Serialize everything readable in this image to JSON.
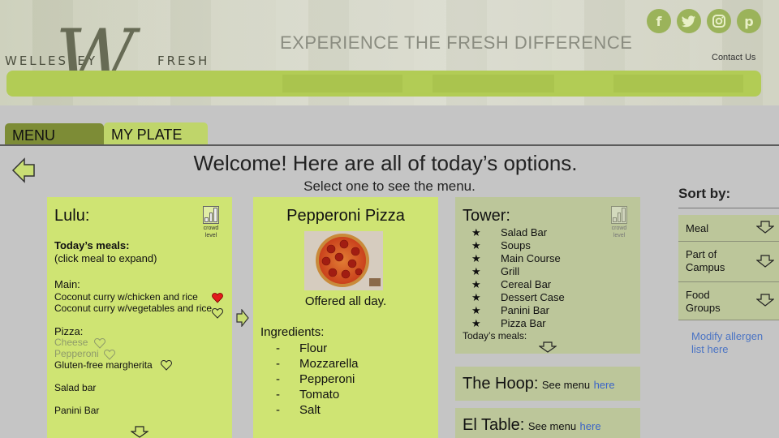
{
  "header": {
    "logo_left": "WELLESLEY",
    "logo_letter": "W",
    "logo_right": "FRESH",
    "tagline": "EXPERIENCE THE FRESH DIFFERENCE",
    "contact_label": "Contact Us",
    "social_icons": [
      {
        "name": "facebook-icon",
        "glyph": "f"
      },
      {
        "name": "twitter-icon",
        "glyph": "t"
      },
      {
        "name": "instagram-icon",
        "glyph": "◎"
      },
      {
        "name": "pinterest-icon",
        "glyph": "p"
      }
    ]
  },
  "tabs": {
    "menu": "MENU",
    "my_plate": "MY PLATE",
    "active": "MENU"
  },
  "main": {
    "welcome": "Welcome! Here are all of today’s options.",
    "subtitle": "Select one to see the menu."
  },
  "crowd_label": "crowd level",
  "lulu": {
    "title": "Lulu:",
    "todays_meals": "Today’s meals:",
    "expand_hint": "(click meal to expand)",
    "main_label": "Main:",
    "main_items": [
      {
        "label": "Coconut curry w/chicken and rice",
        "favorite": true
      },
      {
        "label": "Coconut curry w/vegetables and rice",
        "favorite": false
      }
    ],
    "pizza_label": "Pizza:",
    "pizza_items": [
      {
        "label": "Cheese",
        "available": false
      },
      {
        "label": "Pepperoni",
        "available": false
      },
      {
        "label": "Gluten-free margherita",
        "available": true
      }
    ],
    "salad_bar": "Salad bar",
    "panini_bar": "Panini Bar"
  },
  "pizza_detail": {
    "title": "Pepperoni Pizza",
    "offered": "Offered all day.",
    "ingredients_label": "Ingredients:",
    "ingredients": [
      "Flour",
      "Mozzarella",
      "Pepperoni",
      "Tomato",
      "Salt"
    ],
    "bullet": "-"
  },
  "tower": {
    "title": "Tower:",
    "stations": [
      "Salad Bar",
      "Soups",
      "Main Course",
      "Grill",
      "Cereal Bar",
      "Dessert Case",
      "Panini Bar",
      "Pizza Bar"
    ],
    "todays_meals": "Today’s meals:"
  },
  "hoop": {
    "title": "The Hoop:",
    "see_menu": "See menu",
    "link": "here"
  },
  "eltable": {
    "title": "El Table:",
    "see_menu": "See menu",
    "link": "here"
  },
  "sort": {
    "title": "Sort by:",
    "options": [
      "Meal",
      "Part of Campus",
      "Food Groups"
    ],
    "allergen_link": "Modify allergen list here"
  },
  "colors": {
    "accent_green": "#cfe473",
    "muted_green": "#bcc69a",
    "heart_red": "#e21b1b",
    "link_blue": "#3a64c8"
  }
}
